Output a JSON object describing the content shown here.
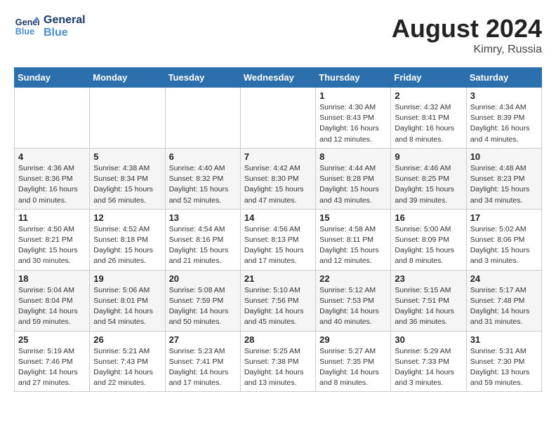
{
  "header": {
    "logo_line1": "General",
    "logo_line2": "Blue",
    "month_year": "August 2024",
    "location": "Kimry, Russia"
  },
  "days_of_week": [
    "Sunday",
    "Monday",
    "Tuesday",
    "Wednesday",
    "Thursday",
    "Friday",
    "Saturday"
  ],
  "weeks": [
    [
      {
        "day": "",
        "info": ""
      },
      {
        "day": "",
        "info": ""
      },
      {
        "day": "",
        "info": ""
      },
      {
        "day": "",
        "info": ""
      },
      {
        "day": "1",
        "info": "Sunrise: 4:30 AM\nSunset: 8:43 PM\nDaylight: 16 hours\nand 12 minutes."
      },
      {
        "day": "2",
        "info": "Sunrise: 4:32 AM\nSunset: 8:41 PM\nDaylight: 16 hours\nand 8 minutes."
      },
      {
        "day": "3",
        "info": "Sunrise: 4:34 AM\nSunset: 8:39 PM\nDaylight: 16 hours\nand 4 minutes."
      }
    ],
    [
      {
        "day": "4",
        "info": "Sunrise: 4:36 AM\nSunset: 8:36 PM\nDaylight: 16 hours\nand 0 minutes."
      },
      {
        "day": "5",
        "info": "Sunrise: 4:38 AM\nSunset: 8:34 PM\nDaylight: 15 hours\nand 56 minutes."
      },
      {
        "day": "6",
        "info": "Sunrise: 4:40 AM\nSunset: 8:32 PM\nDaylight: 15 hours\nand 52 minutes."
      },
      {
        "day": "7",
        "info": "Sunrise: 4:42 AM\nSunset: 8:30 PM\nDaylight: 15 hours\nand 47 minutes."
      },
      {
        "day": "8",
        "info": "Sunrise: 4:44 AM\nSunset: 8:28 PM\nDaylight: 15 hours\nand 43 minutes."
      },
      {
        "day": "9",
        "info": "Sunrise: 4:46 AM\nSunset: 8:25 PM\nDaylight: 15 hours\nand 39 minutes."
      },
      {
        "day": "10",
        "info": "Sunrise: 4:48 AM\nSunset: 8:23 PM\nDaylight: 15 hours\nand 34 minutes."
      }
    ],
    [
      {
        "day": "11",
        "info": "Sunrise: 4:50 AM\nSunset: 8:21 PM\nDaylight: 15 hours\nand 30 minutes."
      },
      {
        "day": "12",
        "info": "Sunrise: 4:52 AM\nSunset: 8:18 PM\nDaylight: 15 hours\nand 26 minutes."
      },
      {
        "day": "13",
        "info": "Sunrise: 4:54 AM\nSunset: 8:16 PM\nDaylight: 15 hours\nand 21 minutes."
      },
      {
        "day": "14",
        "info": "Sunrise: 4:56 AM\nSunset: 8:13 PM\nDaylight: 15 hours\nand 17 minutes."
      },
      {
        "day": "15",
        "info": "Sunrise: 4:58 AM\nSunset: 8:11 PM\nDaylight: 15 hours\nand 12 minutes."
      },
      {
        "day": "16",
        "info": "Sunrise: 5:00 AM\nSunset: 8:09 PM\nDaylight: 15 hours\nand 8 minutes."
      },
      {
        "day": "17",
        "info": "Sunrise: 5:02 AM\nSunset: 8:06 PM\nDaylight: 15 hours\nand 3 minutes."
      }
    ],
    [
      {
        "day": "18",
        "info": "Sunrise: 5:04 AM\nSunset: 8:04 PM\nDaylight: 14 hours\nand 59 minutes."
      },
      {
        "day": "19",
        "info": "Sunrise: 5:06 AM\nSunset: 8:01 PM\nDaylight: 14 hours\nand 54 minutes."
      },
      {
        "day": "20",
        "info": "Sunrise: 5:08 AM\nSunset: 7:59 PM\nDaylight: 14 hours\nand 50 minutes."
      },
      {
        "day": "21",
        "info": "Sunrise: 5:10 AM\nSunset: 7:56 PM\nDaylight: 14 hours\nand 45 minutes."
      },
      {
        "day": "22",
        "info": "Sunrise: 5:12 AM\nSunset: 7:53 PM\nDaylight: 14 hours\nand 40 minutes."
      },
      {
        "day": "23",
        "info": "Sunrise: 5:15 AM\nSunset: 7:51 PM\nDaylight: 14 hours\nand 36 minutes."
      },
      {
        "day": "24",
        "info": "Sunrise: 5:17 AM\nSunset: 7:48 PM\nDaylight: 14 hours\nand 31 minutes."
      }
    ],
    [
      {
        "day": "25",
        "info": "Sunrise: 5:19 AM\nSunset: 7:46 PM\nDaylight: 14 hours\nand 27 minutes."
      },
      {
        "day": "26",
        "info": "Sunrise: 5:21 AM\nSunset: 7:43 PM\nDaylight: 14 hours\nand 22 minutes."
      },
      {
        "day": "27",
        "info": "Sunrise: 5:23 AM\nSunset: 7:41 PM\nDaylight: 14 hours\nand 17 minutes."
      },
      {
        "day": "28",
        "info": "Sunrise: 5:25 AM\nSunset: 7:38 PM\nDaylight: 14 hours\nand 13 minutes."
      },
      {
        "day": "29",
        "info": "Sunrise: 5:27 AM\nSunset: 7:35 PM\nDaylight: 14 hours\nand 8 minutes."
      },
      {
        "day": "30",
        "info": "Sunrise: 5:29 AM\nSunset: 7:33 PM\nDaylight: 14 hours\nand 3 minutes."
      },
      {
        "day": "31",
        "info": "Sunrise: 5:31 AM\nSunset: 7:30 PM\nDaylight: 13 hours\nand 59 minutes."
      }
    ]
  ]
}
